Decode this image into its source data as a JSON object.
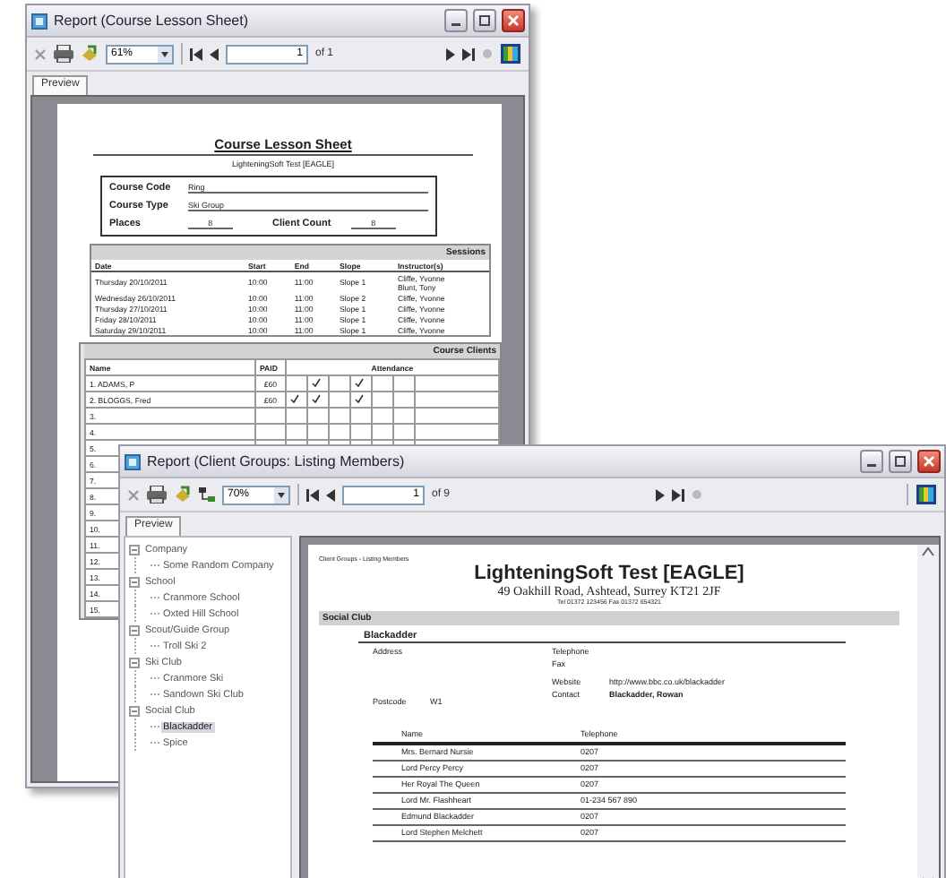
{
  "lesson_report": {
    "title": "Report (Course Lesson Sheet)",
    "zoom": "61%",
    "page": "1",
    "page_count": "of 1",
    "tabs": [
      {
        "label": "Preview",
        "selected": true
      }
    ],
    "heading": "Course Lesson Sheet",
    "subheading": "LighteningSoft Test [EAGLE]",
    "fields": [
      {
        "label": "Course Code",
        "value": "Ring"
      },
      {
        "label": "Course Type",
        "value": "Ski Group"
      }
    ],
    "counts": [
      {
        "label": "Places",
        "value": "8"
      },
      {
        "label": "Client Count",
        "value": "8"
      }
    ],
    "sessions": {
      "title": "Sessions",
      "columns": [
        "Date",
        "Start",
        "End",
        "Slope",
        "Instructor(s)"
      ],
      "rows": [
        {
          "cells": [
            "Thursday 20/10/2011",
            "10:00",
            "11:00",
            "Slope 1"
          ],
          "instructors": [
            "Cliffe, Yvonne",
            "Blunt, Tony"
          ]
        },
        {
          "cells": [
            "Wednesday 26/10/2011",
            "10:00",
            "11:00",
            "Slope 2"
          ],
          "instructors": [
            "Cliffe, Yvonne"
          ]
        },
        {
          "cells": [
            "Thursday 27/10/2011",
            "10:00",
            "11:00",
            "Slope 1"
          ],
          "instructors": [
            "Cliffe, Yvonne"
          ]
        },
        {
          "cells": [
            "Friday 28/10/2011",
            "10:00",
            "11:00",
            "Slope 1"
          ],
          "instructors": [
            "Cliffe, Yvonne"
          ]
        },
        {
          "cells": [
            "Saturday 29/10/2011",
            "10:00",
            "11:00",
            "Slope 1"
          ],
          "instructors": [
            "Cliffe, Yvonne"
          ]
        }
      ]
    },
    "clients": {
      "title": "Course Clients",
      "columns": [
        "Name",
        "PAID",
        "Attendance"
      ],
      "rows": [
        {
          "name": "1. ADAMS, P",
          "paid": "£60",
          "attended": [
            false,
            true,
            false,
            true,
            false,
            false
          ]
        },
        {
          "name": "2. BLOGGS, Fred",
          "paid": "£60",
          "attended": [
            true,
            true,
            false,
            true,
            false,
            false
          ]
        },
        {
          "name": "3."
        },
        {
          "name": "4."
        },
        {
          "name": "5."
        },
        {
          "name": "6."
        },
        {
          "name": "7."
        },
        {
          "name": "8."
        },
        {
          "name": "9."
        },
        {
          "name": "10."
        },
        {
          "name": "11."
        },
        {
          "name": "12."
        },
        {
          "name": "13."
        },
        {
          "name": "14."
        },
        {
          "name": "15."
        }
      ]
    }
  },
  "members_report": {
    "title": "Report (Client Groups: Listing Members)",
    "zoom": "70%",
    "page": "1",
    "page_count": "of 9",
    "tabs": [
      {
        "label": "Preview",
        "selected": true
      }
    ],
    "tree": [
      {
        "label": "Company",
        "expanded": true,
        "children": [
          {
            "label": "Some Random Company",
            "selected": false
          }
        ]
      },
      {
        "label": "School",
        "expanded": true,
        "children": [
          {
            "label": "Cranmore School",
            "selected": false
          },
          {
            "label": "Oxted Hill School",
            "selected": false
          }
        ]
      },
      {
        "label": "Scout/Guide Group",
        "expanded": true,
        "children": [
          {
            "label": "Troll Ski 2",
            "selected": false
          }
        ]
      },
      {
        "label": "Ski Club",
        "expanded": true,
        "children": [
          {
            "label": "Cranmore Ski",
            "selected": false
          },
          {
            "label": "Sandown Ski Club",
            "selected": false
          }
        ]
      },
      {
        "label": "Social Club",
        "expanded": true,
        "children": [
          {
            "label": "Blackadder",
            "selected": true
          },
          {
            "label": "Spice",
            "selected": false
          }
        ]
      }
    ],
    "caption": "Client Groups - Listing Members",
    "heading": "LighteningSoft Test [EAGLE]",
    "address": "49 Oakhill Road, Ashtead, Surrey KT21 2JF",
    "contact_line": "Tel 01372 123456  Fax 01372 654321",
    "group": "Social Club",
    "club": "Blackadder",
    "details_left": [
      {
        "label": "Address"
      },
      {
        "label": "Postcode",
        "value": "W1"
      }
    ],
    "details_right": [
      {
        "label": "Telephone"
      },
      {
        "label": "Fax"
      },
      {
        "label": "Website",
        "value": "http://www.bbc.co.uk/blackadder"
      },
      {
        "label": "Contact",
        "value": "Blackadder, Rowan"
      }
    ],
    "member_columns": [
      "Name",
      "Telephone"
    ],
    "members": [
      [
        "Mrs. Bernard Nursie",
        "0207"
      ],
      [
        "Lord Percy Percy",
        "0207"
      ],
      [
        "Her Royal The Queen",
        "0207"
      ],
      [
        "Lord Mr. Flashheart",
        "01-234 567 890"
      ],
      [
        "Edmund Blackadder",
        "0207"
      ],
      [
        "Lord Stephen Melchett",
        "0207"
      ]
    ]
  }
}
